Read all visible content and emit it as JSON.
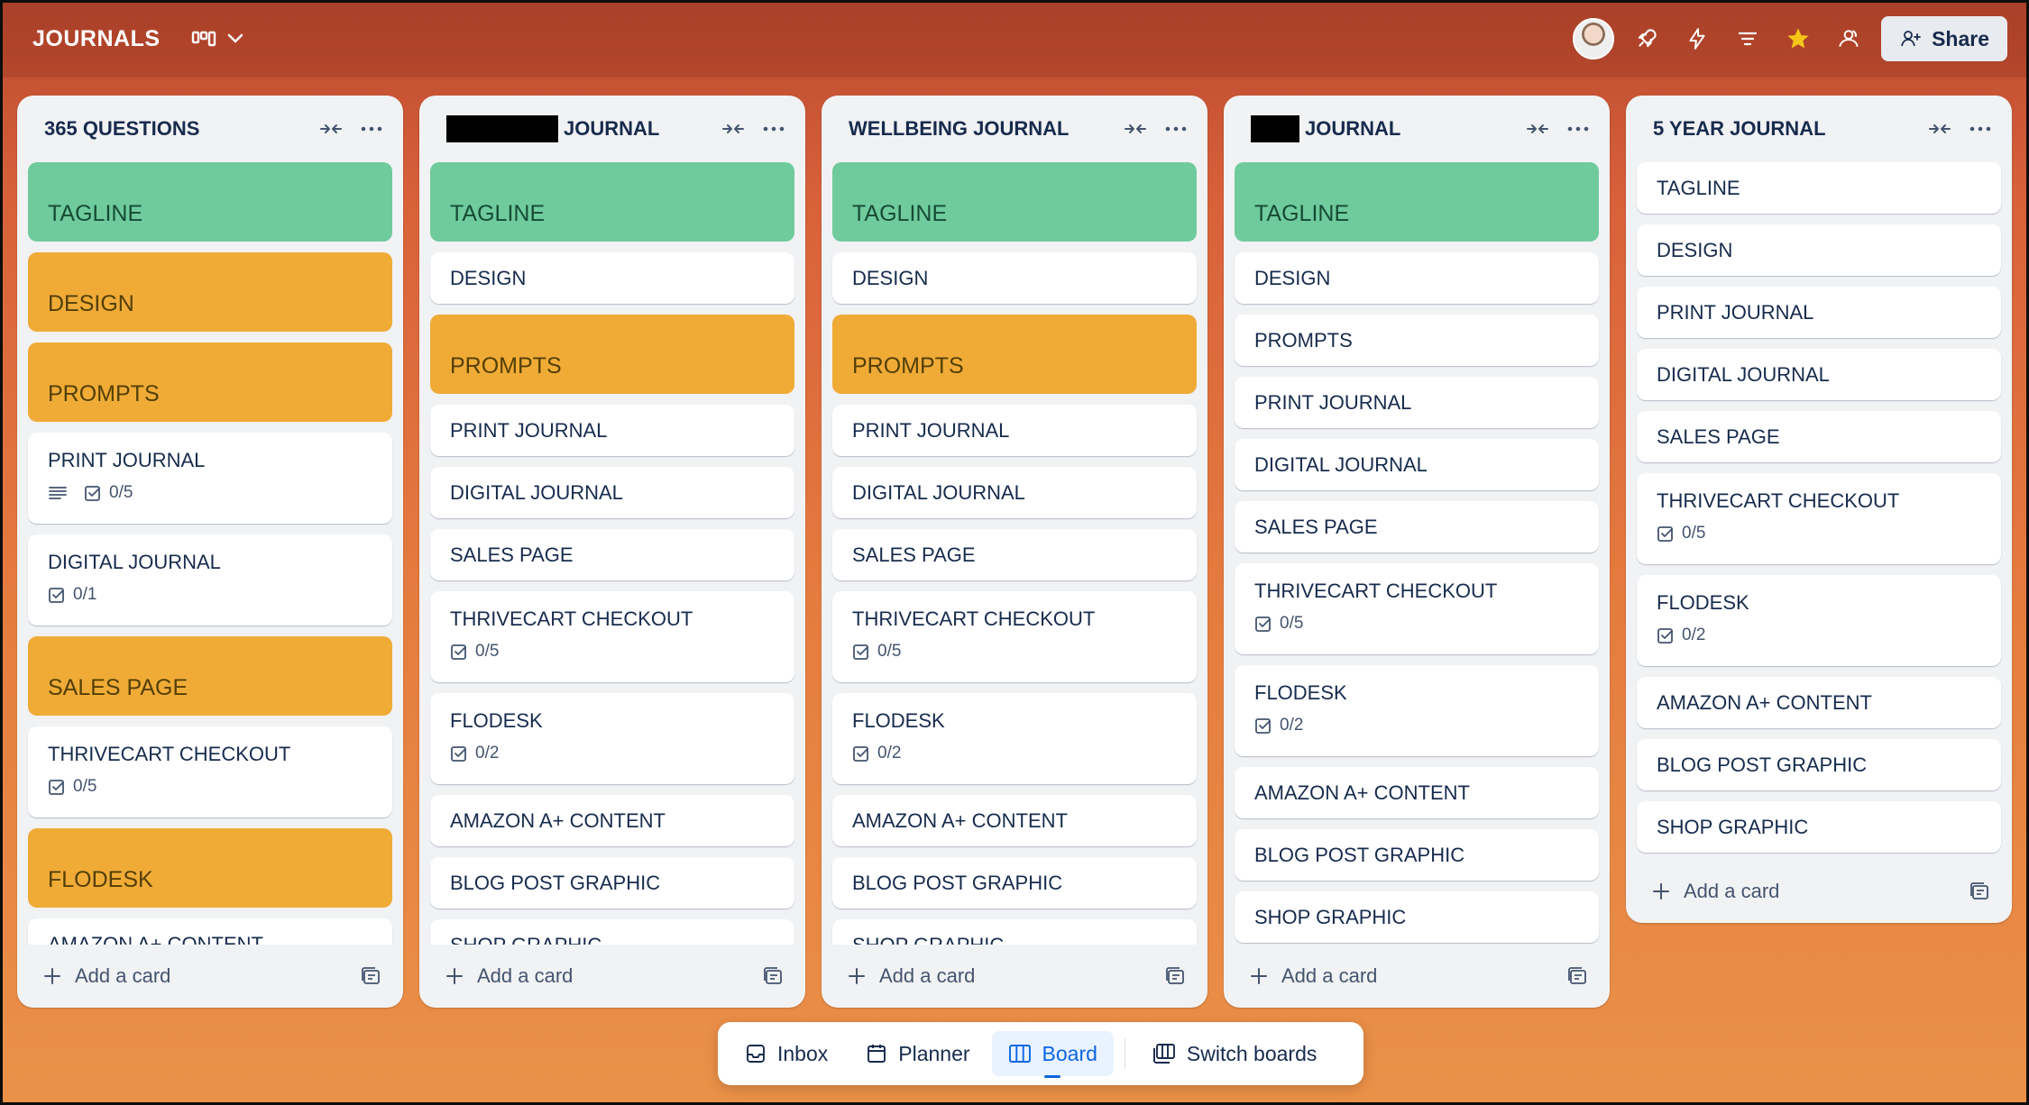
{
  "header": {
    "board_title": "JOURNALS",
    "share_label": "Share"
  },
  "lists": [
    {
      "title": "365 QUESTIONS",
      "cards": [
        {
          "label": "TAGLINE",
          "color": "green"
        },
        {
          "label": "DESIGN",
          "color": "orange"
        },
        {
          "label": "PROMPTS",
          "color": "orange"
        },
        {
          "label": "PRINT JOURNAL",
          "description": true,
          "checklist": "0/5"
        },
        {
          "label": "DIGITAL JOURNAL",
          "checklist": "0/1"
        },
        {
          "label": "SALES PAGE",
          "color": "orange"
        },
        {
          "label": "THRIVECART CHECKOUT",
          "checklist": "0/5"
        },
        {
          "label": "FLODESK",
          "color": "orange"
        },
        {
          "label": "AMAZON A+ CONTENT"
        }
      ],
      "add_card_label": "Add a card"
    },
    {
      "title": "JOURNAL",
      "redacted": true,
      "cards": [
        {
          "label": "TAGLINE",
          "color": "green"
        },
        {
          "label": "DESIGN"
        },
        {
          "label": "PROMPTS",
          "color": "orange"
        },
        {
          "label": "PRINT JOURNAL"
        },
        {
          "label": "DIGITAL JOURNAL"
        },
        {
          "label": "SALES PAGE"
        },
        {
          "label": "THRIVECART CHECKOUT",
          "checklist": "0/5"
        },
        {
          "label": "FLODESK",
          "checklist": "0/2"
        },
        {
          "label": "AMAZON A+ CONTENT"
        },
        {
          "label": "BLOG POST GRAPHIC"
        },
        {
          "label": "SHOP GRAPHIC"
        }
      ],
      "add_card_label": "Add a card"
    },
    {
      "title": "WELLBEING JOURNAL",
      "cards": [
        {
          "label": "TAGLINE",
          "color": "green"
        },
        {
          "label": "DESIGN"
        },
        {
          "label": "PROMPTS",
          "color": "orange"
        },
        {
          "label": "PRINT JOURNAL"
        },
        {
          "label": "DIGITAL JOURNAL"
        },
        {
          "label": "SALES PAGE"
        },
        {
          "label": "THRIVECART CHECKOUT",
          "checklist": "0/5"
        },
        {
          "label": "FLODESK",
          "checklist": "0/2"
        },
        {
          "label": "AMAZON A+ CONTENT"
        },
        {
          "label": "BLOG POST GRAPHIC"
        },
        {
          "label": "SHOP GRAPHIC"
        }
      ],
      "add_card_label": "Add a card"
    },
    {
      "title": "JOURNAL",
      "redacted": true,
      "cards": [
        {
          "label": "TAGLINE",
          "color": "green"
        },
        {
          "label": "DESIGN"
        },
        {
          "label": "PROMPTS"
        },
        {
          "label": "PRINT JOURNAL"
        },
        {
          "label": "DIGITAL JOURNAL"
        },
        {
          "label": "SALES PAGE"
        },
        {
          "label": "THRIVECART CHECKOUT",
          "checklist": "0/5"
        },
        {
          "label": "FLODESK",
          "checklist": "0/2"
        },
        {
          "label": "AMAZON A+ CONTENT"
        },
        {
          "label": "BLOG POST GRAPHIC"
        },
        {
          "label": "SHOP GRAPHIC"
        }
      ],
      "add_card_label": "Add a card"
    },
    {
      "title": "5 YEAR JOURNAL",
      "cards": [
        {
          "label": "TAGLINE"
        },
        {
          "label": "DESIGN"
        },
        {
          "label": "PRINT JOURNAL"
        },
        {
          "label": "DIGITAL JOURNAL"
        },
        {
          "label": "SALES PAGE"
        },
        {
          "label": "THRIVECART CHECKOUT",
          "checklist": "0/5"
        },
        {
          "label": "FLODESK",
          "checklist": "0/2"
        },
        {
          "label": "AMAZON A+ CONTENT"
        },
        {
          "label": "BLOG POST GRAPHIC"
        },
        {
          "label": "SHOP GRAPHIC"
        }
      ],
      "add_card_label": "Add a card"
    }
  ],
  "bottom_nav": {
    "inbox": "Inbox",
    "planner": "Planner",
    "board": "Board",
    "switch_boards": "Switch boards"
  },
  "colors": {
    "green": "#6fcb9c",
    "orange": "#f0ab37",
    "accent": "#0c66e4"
  }
}
